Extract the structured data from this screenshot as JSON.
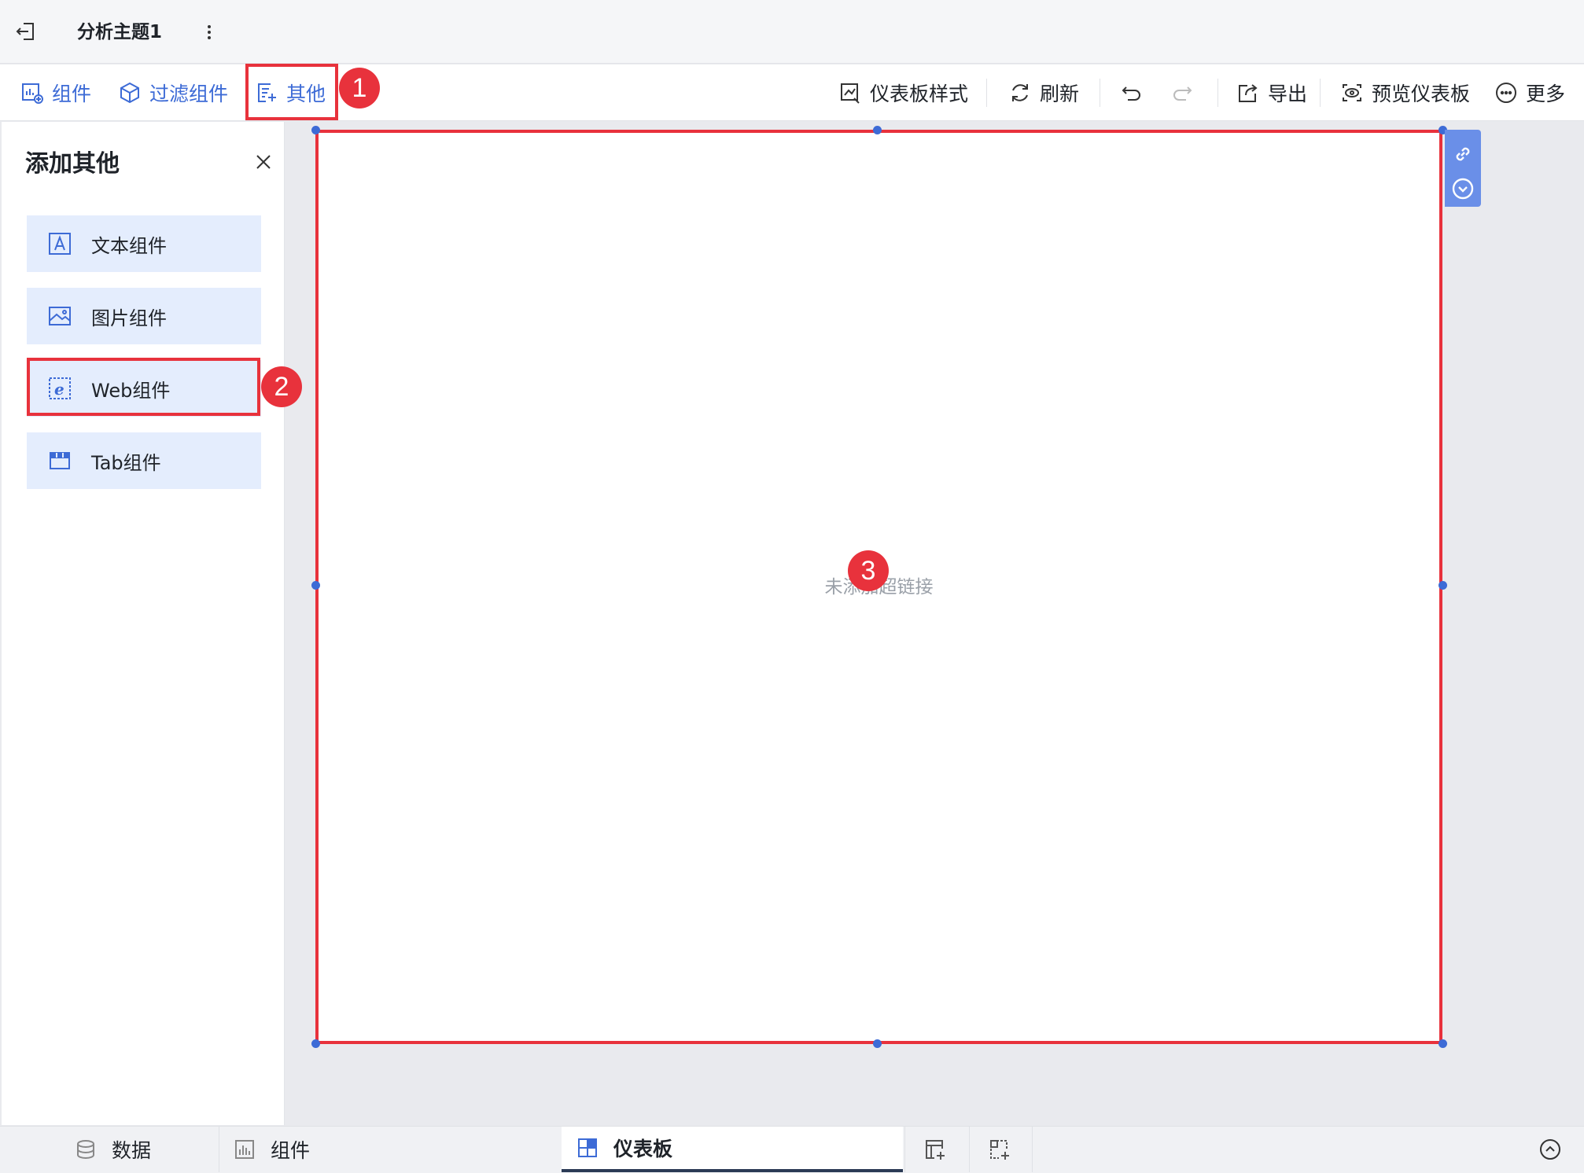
{
  "header": {
    "title": "分析主题1",
    "exit_icon": "exit-icon",
    "more_icon": "kebab-icon"
  },
  "toolbar": {
    "left": [
      {
        "label": "组件",
        "icon": "add-chart-icon"
      },
      {
        "label": "过滤组件",
        "icon": "filter-cube-icon"
      },
      {
        "label": "其他",
        "icon": "add-other-icon"
      }
    ],
    "right": [
      {
        "label": "仪表板样式",
        "icon": "dashboard-style-icon"
      },
      {
        "label": "刷新",
        "icon": "refresh-icon"
      },
      {
        "label": "",
        "icon": "undo-icon"
      },
      {
        "label": "",
        "icon": "redo-icon"
      },
      {
        "label": "导出",
        "icon": "export-icon"
      },
      {
        "label": "预览仪表板",
        "icon": "preview-icon"
      },
      {
        "label": "更多",
        "icon": "more-icon"
      }
    ]
  },
  "panel": {
    "title": "添加其他",
    "items": [
      {
        "label": "文本组件",
        "icon": "text-icon"
      },
      {
        "label": "图片组件",
        "icon": "image-icon"
      },
      {
        "label": "Web组件",
        "icon": "web-icon"
      },
      {
        "label": "Tab组件",
        "icon": "tab-icon"
      }
    ]
  },
  "canvas": {
    "placeholder": "未添加超链接",
    "tools": [
      "link-icon",
      "chevron-down-circle-icon"
    ]
  },
  "bottom": {
    "tabs": [
      {
        "label": "数据",
        "icon": "database-icon"
      },
      {
        "label": "组件",
        "icon": "bar-chart-icon"
      },
      {
        "label": "仪表板",
        "icon": "dashboard-icon",
        "active": true
      }
    ],
    "extra_icons": [
      "add-dashboard-icon",
      "add-component-icon",
      "collapse-up-icon"
    ]
  },
  "annotations": [
    "1",
    "2",
    "3"
  ],
  "colors": {
    "accent": "#3d6bd6",
    "annotation": "#e8323c",
    "panel_item_bg": "#e4edfd"
  }
}
